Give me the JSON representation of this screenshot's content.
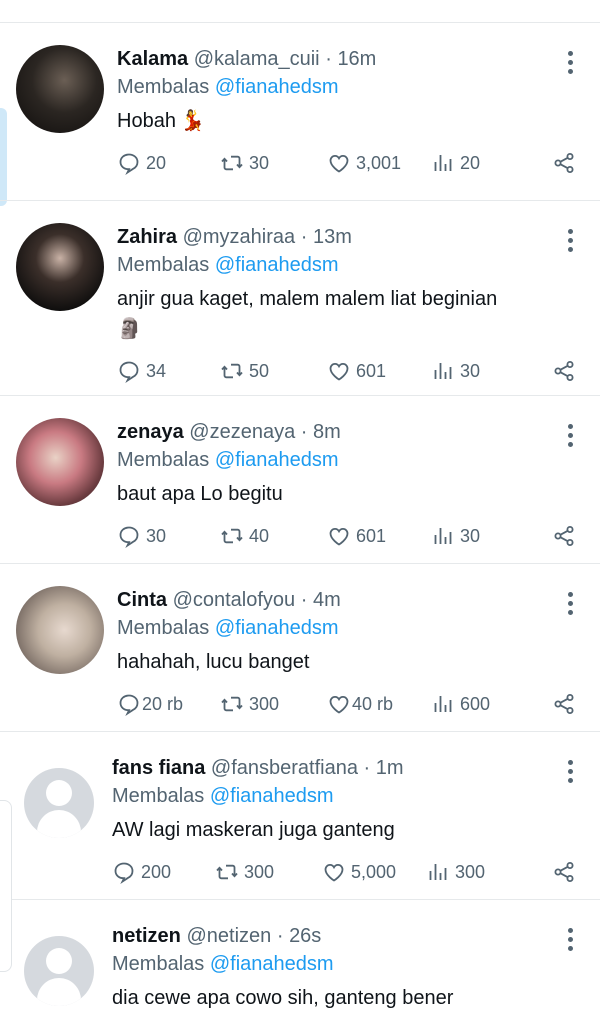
{
  "tweets": [
    {
      "name": "Kalama",
      "handle": "@kalama_cuii",
      "time": "16m",
      "reply_prefix": "Membalas",
      "reply_to": "@fianahedsm",
      "text": "Hobah",
      "emoji": "💃",
      "replies": "20",
      "retweets": "30",
      "likes": "3,001",
      "views": "20"
    },
    {
      "name": "Zahira",
      "handle": "@myzahiraa",
      "time": "13m",
      "reply_prefix": "Membalas",
      "reply_to": "@fianahedsm",
      "text": "anjir gua kaget, malem malem liat beginian",
      "emoji": "🗿",
      "replies": "34",
      "retweets": "50",
      "likes": "601",
      "views": "30"
    },
    {
      "name": "zenaya",
      "handle": "@zezenaya",
      "time": "8m",
      "reply_prefix": "Membalas",
      "reply_to": "@fianahedsm",
      "text": "baut apa Lo begitu",
      "replies": "30",
      "retweets": "40",
      "likes": "601",
      "views": "30"
    },
    {
      "name": "Cinta",
      "handle": "@contalofyou",
      "time": "4m",
      "reply_prefix": "Membalas",
      "reply_to": "@fianahedsm",
      "text": "hahahah, lucu banget",
      "replies": "20 rb",
      "retweets": "300",
      "likes": "40 rb",
      "views": "600"
    },
    {
      "name": "fans fiana",
      "handle": "@fansberatfiana",
      "time": "1m",
      "reply_prefix": "Membalas",
      "reply_to": "@fianahedsm",
      "text": "AW lagi maskeran juga ganteng",
      "replies": "200",
      "retweets": "300",
      "likes": "5,000",
      "views": "300"
    },
    {
      "name": "netizen",
      "handle": "@netizen",
      "time": "26s",
      "reply_prefix": "Membalas",
      "reply_to": "@fianahedsm",
      "text": "dia cewe apa cowo sih, ganteng bener"
    }
  ]
}
